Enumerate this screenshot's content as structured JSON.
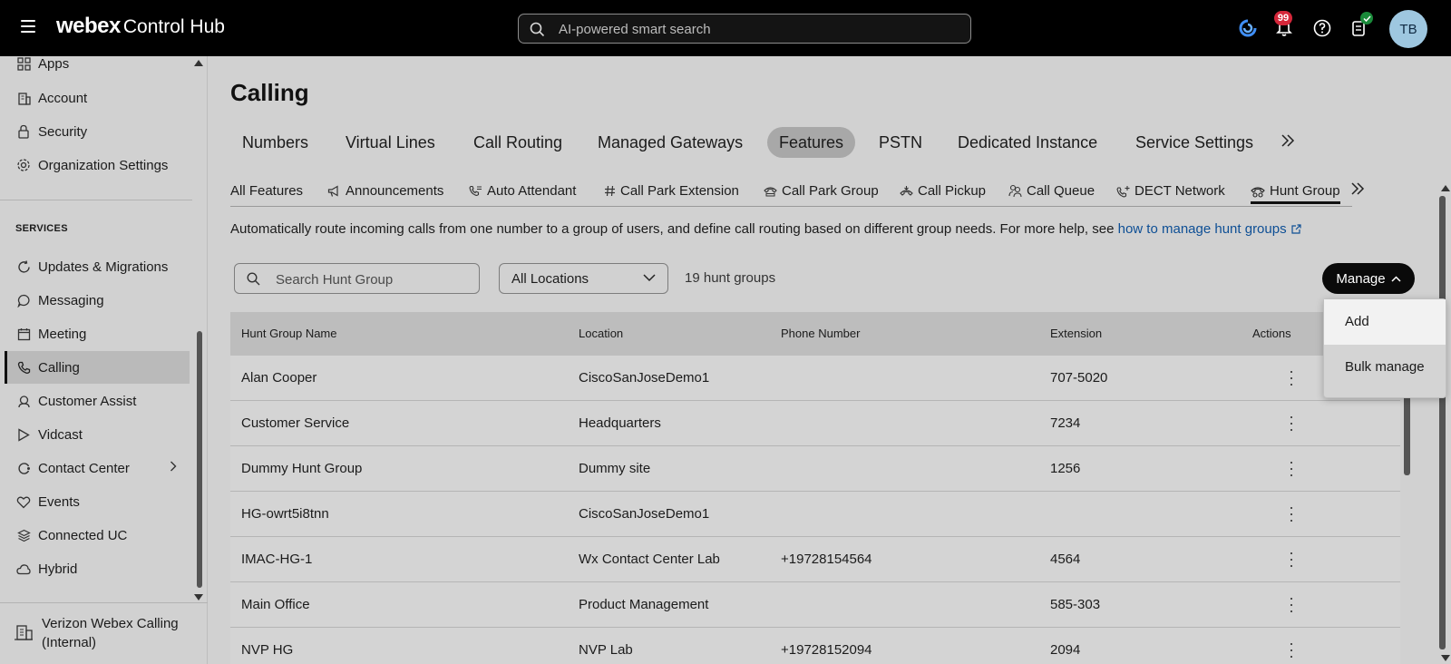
{
  "header": {
    "brand_bold": "webex",
    "brand_rest": "Control Hub",
    "search_placeholder": "AI-powered smart search",
    "notification_count": "99",
    "avatar_initials": "TB"
  },
  "sidebar": {
    "items_top": [
      {
        "label": "Apps",
        "icon": "apps-icon"
      },
      {
        "label": "Account",
        "icon": "building-icon"
      },
      {
        "label": "Security",
        "icon": "lock-icon"
      },
      {
        "label": "Organization Settings",
        "icon": "gear-icon"
      }
    ],
    "section_label": "SERVICES",
    "services": [
      {
        "label": "Updates & Migrations",
        "icon": "refresh-icon"
      },
      {
        "label": "Messaging",
        "icon": "chat-icon"
      },
      {
        "label": "Meeting",
        "icon": "calendar-icon"
      },
      {
        "label": "Calling",
        "icon": "phone-icon",
        "active": true
      },
      {
        "label": "Customer Assist",
        "icon": "headset-icon"
      },
      {
        "label": "Vidcast",
        "icon": "play-icon"
      },
      {
        "label": "Contact Center",
        "icon": "contact-center-icon"
      },
      {
        "label": "Events",
        "icon": "events-icon"
      },
      {
        "label": "Connected UC",
        "icon": "layers-icon"
      },
      {
        "label": "Hybrid",
        "icon": "cloud-icon"
      }
    ],
    "footer_org": "Verizon Webex Calling (Internal)"
  },
  "main": {
    "title": "Calling",
    "tabs": [
      "Numbers",
      "Virtual Lines",
      "Call Routing",
      "Managed Gateways",
      "Features",
      "PSTN",
      "Dedicated Instance",
      "Service Settings"
    ],
    "active_tab": "Features",
    "subtabs": [
      "All Features",
      "Announcements",
      "Auto Attendant",
      "Call Park Extension",
      "Call Park Group",
      "Call Pickup",
      "Call Queue",
      "DECT Network",
      "Hunt Group"
    ],
    "active_subtab": "Hunt Group",
    "description": "Automatically route incoming calls from one number to a group of users, and define call routing based on different group needs. For more help, see ",
    "help_link": "how to manage hunt groups",
    "search_placeholder": "Search Hunt Group",
    "location_filter": "All Locations",
    "count_text": "19 hunt groups",
    "manage_label": "Manage",
    "manage_menu": [
      "Add",
      "Bulk manage"
    ],
    "table": {
      "columns": [
        "Hunt Group Name",
        "Location",
        "Phone Number",
        "Extension",
        "Actions"
      ],
      "rows": [
        {
          "name": "Alan Cooper",
          "location": "CiscoSanJoseDemo1",
          "phone": "",
          "extension": "707-5020"
        },
        {
          "name": "Customer Service",
          "location": "Headquarters",
          "phone": "",
          "extension": "7234"
        },
        {
          "name": "Dummy Hunt Group",
          "location": "Dummy site",
          "phone": "",
          "extension": "1256"
        },
        {
          "name": "HG-owrt5i8tnn",
          "location": "CiscoSanJoseDemo1",
          "phone": "",
          "extension": ""
        },
        {
          "name": "IMAC-HG-1",
          "location": "Wx Contact Center Lab",
          "phone": "+19728154564",
          "extension": "4564"
        },
        {
          "name": "Main Office",
          "location": "Product Management",
          "phone": "",
          "extension": "585-303"
        },
        {
          "name": "NVP HG",
          "location": "NVP Lab",
          "phone": "+19728152094",
          "extension": "2094"
        }
      ]
    }
  },
  "colors": {
    "topbar": "#000000",
    "background": "#d1d1d1",
    "link": "#0e4f95",
    "badge": "#d4273a",
    "avatar": "#9ec7e0"
  }
}
